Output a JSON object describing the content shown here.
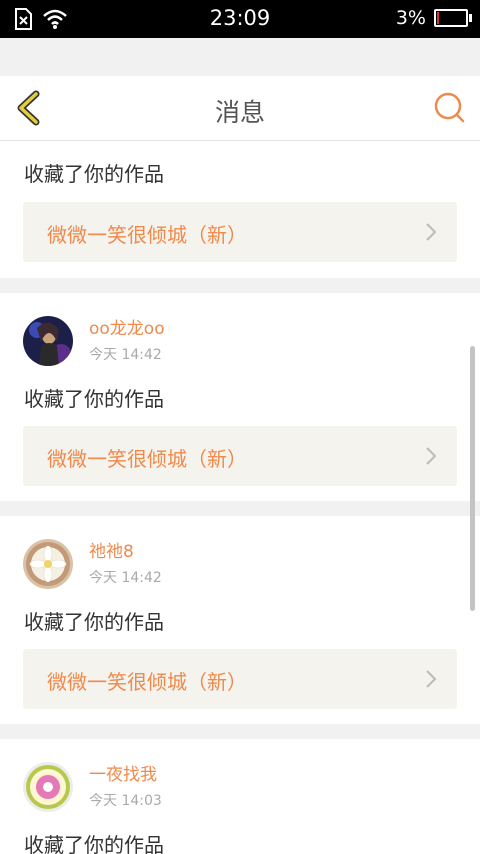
{
  "status_bar": {
    "time": "23:09",
    "battery": "3%"
  },
  "header": {
    "title": "消息"
  },
  "partial_card": {
    "action": "收藏了你的作品",
    "work_title": "微微一笑很倾城（新）"
  },
  "messages": [
    {
      "username": "oo龙龙oo",
      "time": "今天 14:42",
      "action": "收藏了你的作品",
      "work_title": "微微一笑很倾城（新）"
    },
    {
      "username": "祂祂8",
      "time": "今天 14:42",
      "action": "收藏了你的作品",
      "work_title": "微微一笑很倾城（新）"
    },
    {
      "username": "一夜找我",
      "time": "今天 14:03",
      "action": "收藏了你的作品"
    }
  ],
  "colors": {
    "accent": "#f08a4b",
    "back_icon": "#e4cd3a"
  }
}
